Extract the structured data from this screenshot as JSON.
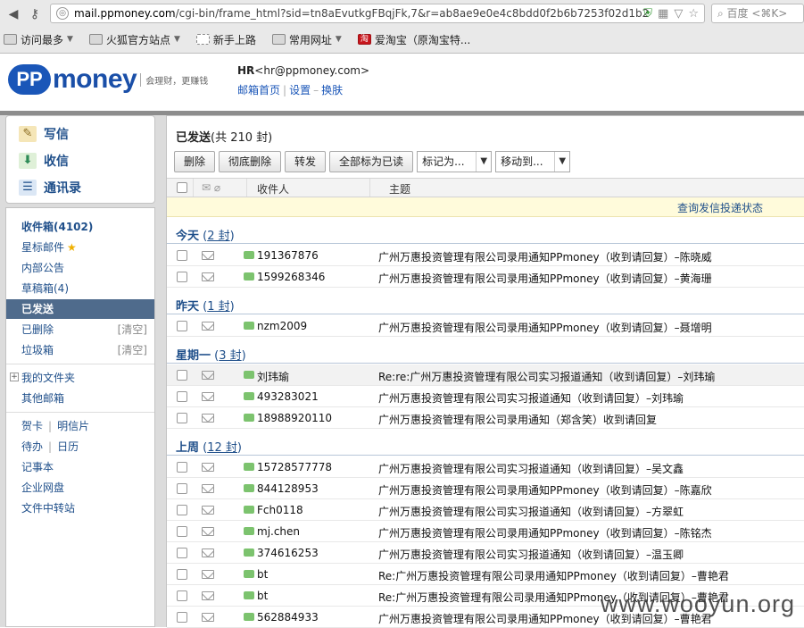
{
  "browser": {
    "url_prefix": "mail.ppmoney.com",
    "url_rest": "/cgi-bin/frame_html?sid=tn8aEvutkgFBqjFk,7&r=ab8ae9e0e4c8bdd0f2b6b7253f02d1b2",
    "search_placeholder": "百度 <⌘K>",
    "bookmarks": [
      {
        "label": "访问最多",
        "dropdown": true
      },
      {
        "label": "火狐官方站点",
        "dropdown": true
      },
      {
        "label": "新手上路",
        "dropdown": false
      },
      {
        "label": "常用网址",
        "dropdown": true
      },
      {
        "label": "爱淘宝（原淘宝特...",
        "dropdown": false
      }
    ]
  },
  "header": {
    "logo_pp": "PP",
    "logo_money": "money",
    "slogan": "会理财，更赚钱",
    "user_name": "HR",
    "user_email": "<hr@ppmoney.com>",
    "links": [
      "邮箱首页",
      "设置",
      "换肤"
    ]
  },
  "sidebar": {
    "compose": [
      "写信",
      "收信",
      "通讯录"
    ],
    "folders": [
      {
        "label": "收件箱(4102)"
      },
      {
        "label": "星标邮件"
      },
      {
        "label": "内部公告"
      },
      {
        "label": "草稿箱(4)"
      },
      {
        "label": "已发送"
      },
      {
        "label": "已删除",
        "action": "[清空]"
      },
      {
        "label": "垃圾箱",
        "action": "[清空]"
      }
    ],
    "my_folders": "我的文件夹",
    "other_mailbox": "其他邮箱",
    "tools": [
      {
        "a": "贺卡",
        "b": "明信片"
      },
      {
        "a": "待办",
        "b": "日历"
      }
    ],
    "extras": [
      "记事本",
      "企业网盘",
      "文件中转站"
    ]
  },
  "main": {
    "title": "已发送",
    "title_count": "(共 210 封)",
    "buttons": [
      "删除",
      "彻底删除",
      "转发",
      "全部标为已读"
    ],
    "selects": [
      "标记为...",
      "移动到..."
    ],
    "col_recipient": "收件人",
    "col_subject": "主题",
    "notice_link": "查询发信投递状态",
    "groups": [
      {
        "name": "今天",
        "count": "2 封"
      },
      {
        "name": "昨天",
        "count": "1 封"
      },
      {
        "name": "星期一",
        "count": "3 封"
      },
      {
        "name": "上周",
        "count": "12 封"
      }
    ],
    "rows": [
      {
        "to": "191367876",
        "subject": "广州万惠投资管理有限公司录用通知PPmoney（收到请回复）–陈晓威"
      },
      {
        "to": "1599268346",
        "subject": "广州万惠投资管理有限公司录用通知PPmoney（收到请回复）–黄海珊"
      },
      {
        "to": "nzm2009",
        "subject": "广州万惠投资管理有限公司录用通知PPmoney（收到请回复）–聂增明"
      },
      {
        "to": "刘玮瑜",
        "subject": "Re:re:广州万惠投资管理有限公司实习报道通知（收到请回复）–刘玮瑜"
      },
      {
        "to": "493283021",
        "subject": "广州万惠投资管理有限公司实习报道通知（收到请回复）–刘玮瑜"
      },
      {
        "to": "18988920110",
        "subject": "广州万惠投资管理有限公司录用通知（郑含笑）收到请回复"
      },
      {
        "to": "15728577778",
        "subject": "广州万惠投资管理有限公司实习报道通知（收到请回复）–吴文鑫"
      },
      {
        "to": "844128953",
        "subject": "广州万惠投资管理有限公司录用通知PPmoney（收到请回复）–陈嘉欣"
      },
      {
        "to": "Fch0118",
        "subject": "广州万惠投资管理有限公司实习报道通知（收到请回复）–方翠虹"
      },
      {
        "to": "mj.chen",
        "subject": "广州万惠投资管理有限公司录用通知PPmoney（收到请回复）–陈铭杰"
      },
      {
        "to": "374616253",
        "subject": "广州万惠投资管理有限公司实习报道通知（收到请回复）–温玉卿"
      },
      {
        "to": "bt",
        "subject": "Re:广州万惠投资管理有限公司录用通知PPmoney（收到请回复）–曹艳君"
      },
      {
        "to": "bt",
        "subject": "Re:广州万惠投资管理有限公司录用通知PPmoney（收到请回复）–曹艳君"
      },
      {
        "to": "562884933",
        "subject": "广州万惠投资管理有限公司录用通知PPmoney（收到请回复）–曹艳君"
      }
    ]
  },
  "watermark": "www.wooyun.org"
}
